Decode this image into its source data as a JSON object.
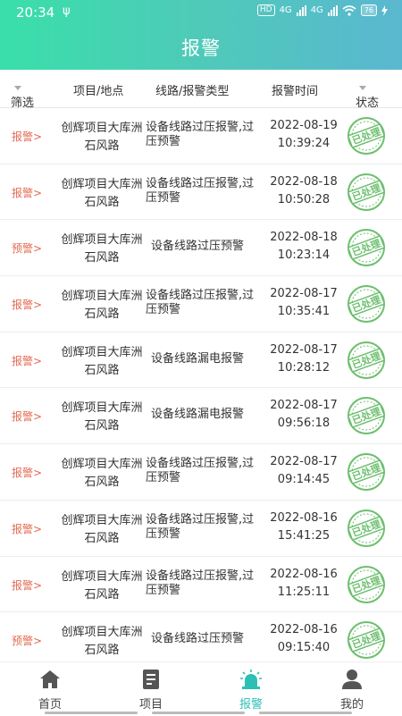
{
  "status_bar": {
    "time": "20:34",
    "usb": "ψ",
    "hd": "HD",
    "net1": "4G",
    "net2": "4G",
    "battery": "76"
  },
  "header": {
    "title": "报警"
  },
  "columns": {
    "filter": "筛选",
    "project": "项目/地点",
    "line_type": "线路/报警类型",
    "alarm_time": "报警时间",
    "status": "状态"
  },
  "rows": [
    {
      "type": "报警>",
      "loc_line1": "创辉项目大库洲",
      "loc_line2": "石风路",
      "alarm": "设备线路过压报警,过压预警",
      "date": "2022-08-19",
      "time": "10:39:24",
      "stamp": "已处理"
    },
    {
      "type": "报警>",
      "loc_line1": "创辉项目大库洲",
      "loc_line2": "石风路",
      "alarm": "设备线路过压报警,过压预警",
      "date": "2022-08-18",
      "time": "10:50:28",
      "stamp": "已处理"
    },
    {
      "type": "预警>",
      "loc_line1": "创辉项目大库洲",
      "loc_line2": "石风路",
      "alarm": "设备线路过压预警",
      "date": "2022-08-18",
      "time": "10:23:14",
      "stamp": "已处理"
    },
    {
      "type": "报警>",
      "loc_line1": "创辉项目大库洲",
      "loc_line2": "石风路",
      "alarm": "设备线路过压报警,过压预警",
      "date": "2022-08-17",
      "time": "10:35:41",
      "stamp": "已处理"
    },
    {
      "type": "报警>",
      "loc_line1": "创辉项目大库洲",
      "loc_line2": "石风路",
      "alarm": "设备线路漏电报警",
      "date": "2022-08-17",
      "time": "10:28:12",
      "stamp": "已处理"
    },
    {
      "type": "报警>",
      "loc_line1": "创辉项目大库洲",
      "loc_line2": "石风路",
      "alarm": "设备线路漏电报警",
      "date": "2022-08-17",
      "time": "09:56:18",
      "stamp": "已处理"
    },
    {
      "type": "报警>",
      "loc_line1": "创辉项目大库洲",
      "loc_line2": "石风路",
      "alarm": "设备线路过压报警,过压预警",
      "date": "2022-08-17",
      "time": "09:14:45",
      "stamp": "已处理"
    },
    {
      "type": "报警>",
      "loc_line1": "创辉项目大库洲",
      "loc_line2": "石风路",
      "alarm": "设备线路过压报警,过压预警",
      "date": "2022-08-16",
      "time": "15:41:25",
      "stamp": "已处理"
    },
    {
      "type": "报警>",
      "loc_line1": "创辉项目大库洲",
      "loc_line2": "石风路",
      "alarm": "设备线路过压报警,过压预警",
      "date": "2022-08-16",
      "time": "11:25:11",
      "stamp": "已处理"
    },
    {
      "type": "预警>",
      "loc_line1": "创辉项目大库洲",
      "loc_line2": "石风路",
      "alarm": "设备线路过压预警",
      "date": "2022-08-16",
      "time": "09:15:40",
      "stamp": "已处理"
    }
  ],
  "tabs": [
    {
      "label": "首页",
      "icon": "home-icon",
      "active": false
    },
    {
      "label": "项目",
      "icon": "project-icon",
      "active": false
    },
    {
      "label": "报警",
      "icon": "alarm-icon",
      "active": true
    },
    {
      "label": "我的",
      "icon": "user-icon",
      "active": false
    }
  ],
  "colors": {
    "header_start": "#39dfa9",
    "header_end": "#5ab7d0",
    "alarm_red": "#e36a52",
    "stamp_green": "#6cbf6e",
    "active_tab": "#2dbfb5"
  }
}
